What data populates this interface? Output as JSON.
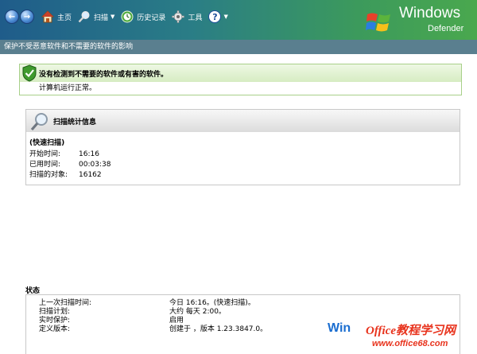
{
  "toolbar": {
    "back_glyph": "←",
    "forward_glyph": "→",
    "home_label": "主页",
    "scan_label": "扫描",
    "history_label": "历史记录",
    "tools_label": "工具",
    "help_glyph": "?",
    "dropdown_glyph": "▼"
  },
  "brand": {
    "windows": "Windows",
    "defender": "Defender"
  },
  "subtitle": "保护不受恶意软件和不需要的软件的影响",
  "status": {
    "heading": "没有检测到不需要的软件或有害的软件。",
    "message": "计算机运行正常。"
  },
  "scan_stats": {
    "heading": "扫描统计信息",
    "type": "(快速扫描)",
    "rows": [
      {
        "label": "开始时间:",
        "value": "16:16"
      },
      {
        "label": "已用时间:",
        "value": "00:03:38"
      },
      {
        "label": "扫描的对象:",
        "value": "16162"
      }
    ]
  },
  "state": {
    "heading": "状态",
    "rows": [
      {
        "label": "上一次扫描时间:",
        "value": "今日 16:16。(快速扫描)。"
      },
      {
        "label": "扫描计划:",
        "value": "大约 每天 2:00。"
      },
      {
        "label": "实时保护:",
        "value": "启用"
      },
      {
        "label": "定义版本:",
        "value": "创建于                  ，版本 1.23.3847.0。"
      }
    ]
  },
  "watermark": {
    "win": "Win",
    "office": "Office教程学习网",
    "url": "www.office68.com"
  },
  "icons": {
    "home": "home-icon",
    "scan": "magnifier-icon",
    "history": "history-icon",
    "tools": "gear-icon",
    "help": "help-icon",
    "status": "shield-check-icon",
    "stats": "magnifier-icon"
  },
  "colors": {
    "header_start": "#1f5c8a",
    "header_end": "#4aa84e",
    "status_border": "#a8d08a",
    "status_head": "#d6ecc2",
    "watermark_red": "#e8331d",
    "watermark_blue": "#1b6ed0"
  }
}
